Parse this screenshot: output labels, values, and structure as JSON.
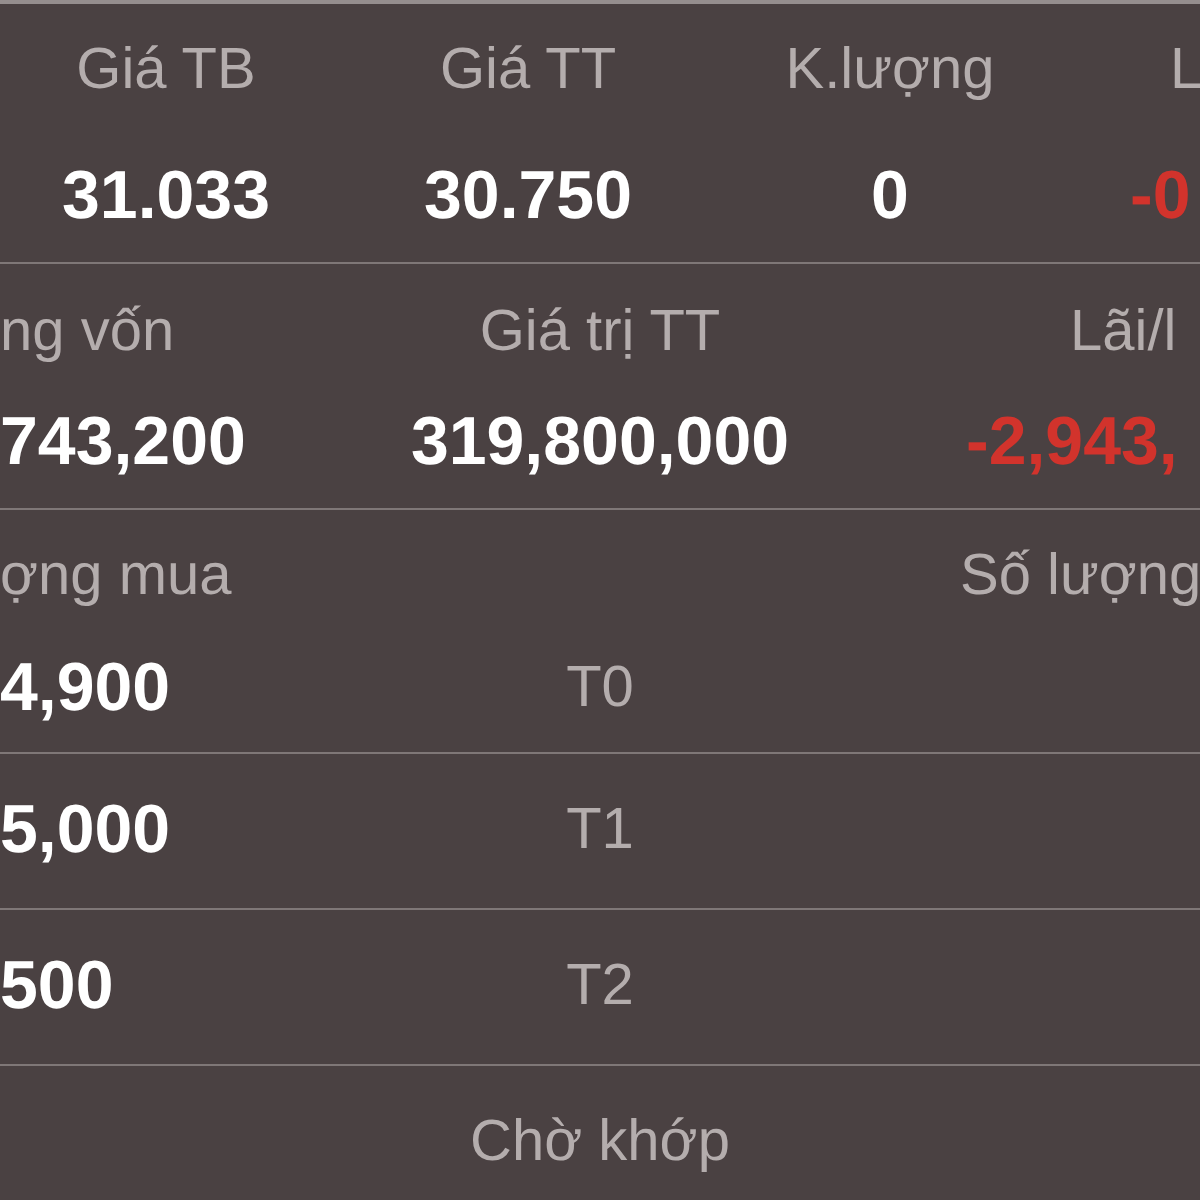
{
  "position_summary": {
    "columns": [
      {
        "label": "Giá TB",
        "value": "31.033",
        "negative": false
      },
      {
        "label": "Giá TT",
        "value": "30.750",
        "negative": false
      },
      {
        "label": "K.lượng",
        "value": "0",
        "negative": false
      },
      {
        "label": "L",
        "value": "-0",
        "negative": true
      }
    ]
  },
  "value_summary": {
    "columns": [
      {
        "label": "ng vốn",
        "value": "743,200",
        "negative": false
      },
      {
        "label": "Giá trị TT",
        "value": "319,800,000",
        "negative": false
      },
      {
        "label": "Lãi/l",
        "value": "-2,943,",
        "negative": true
      }
    ]
  },
  "settlement": {
    "header": {
      "column_1": "ợng mua",
      "column_3": "Số lượng"
    },
    "rows": [
      {
        "column_1": "4,900",
        "column_2": "T0"
      },
      {
        "column_1": "5,000",
        "column_2": "T1"
      },
      {
        "column_1": "500",
        "column_2": "T2"
      },
      {
        "column_2": "Chờ khớp"
      }
    ]
  }
}
